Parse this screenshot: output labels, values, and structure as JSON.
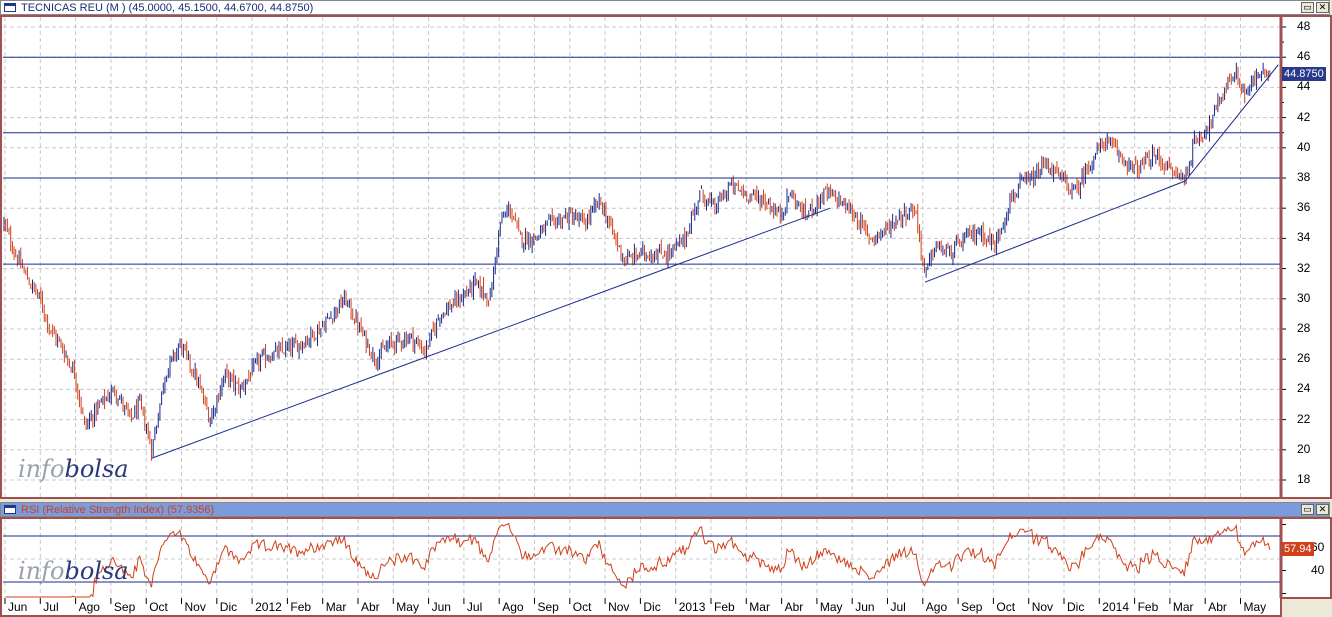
{
  "main_window": {
    "title": "TECNICAS REU (M ) (45.0000, 45.1500, 44.6700, 44.8750)",
    "last_price": "44.8750",
    "restore_icon": "restore-icon",
    "close_icon": "close-icon"
  },
  "rsi_window": {
    "title": "RSI (Relative Strength Index) (57.9356)",
    "last_value": "57.94"
  },
  "watermark": {
    "part1": "info",
    "part2": "bolsa"
  },
  "colors": {
    "up": "#1a2a8a",
    "down": "#d0401a",
    "line": "#1a2a8a",
    "rsi": "#d0401a",
    "frame": "#a05050"
  },
  "chart_data": [
    {
      "type": "ohlc",
      "title": "TECNICAS REU (M )",
      "ylim": [
        17,
        49
      ],
      "yticks": [
        18,
        20,
        22,
        24,
        26,
        28,
        30,
        32,
        34,
        36,
        38,
        40,
        42,
        44,
        46,
        48
      ],
      "x_unit": "months since Jun 2011",
      "keypoints": {
        "t": [
          0,
          0.31,
          0.74,
          1.02,
          1.3,
          1.59,
          2.01,
          2.29,
          2.72,
          3.14,
          3.57,
          3.85,
          4.19,
          4.56,
          4.99,
          5.41,
          5.84,
          6.26,
          6.69,
          7.25,
          7.82,
          8.39,
          8.95,
          9.66,
          10.08,
          10.51,
          10.93,
          11.5,
          11.93,
          12.35,
          12.92,
          13.34,
          13.77,
          14.05,
          14.33,
          14.62,
          15.04,
          15.47,
          16.03,
          16.46,
          16.88,
          17.31,
          17.59,
          18.02,
          18.44,
          18.87,
          19.29,
          19.72,
          20.14,
          20.57,
          20.99,
          21.56,
          21.98,
          22.27,
          22.69,
          23.26,
          23.68,
          24.11,
          24.53,
          24.96,
          25.38,
          25.81,
          26.09,
          26.37,
          26.8,
          27.22,
          27.65,
          28.07,
          28.5,
          28.78,
          29.21,
          29.49,
          29.92,
          30.34,
          30.76,
          31.19,
          31.61,
          32.04,
          32.61,
          33.03,
          33.46,
          33.74,
          34.16,
          34.59,
          34.87,
          35.16,
          35.58,
          35.86
        ],
        "close": [
          35,
          33,
          31,
          30,
          28,
          27,
          25,
          21.5,
          23,
          24,
          22,
          23,
          20,
          25,
          27,
          25,
          22,
          25,
          24,
          26,
          26.5,
          27,
          28,
          30,
          28,
          26,
          27,
          27.5,
          26.5,
          29,
          30,
          31,
          30,
          35,
          36,
          34,
          34,
          35,
          35.5,
          35,
          36.5,
          34,
          32.5,
          33,
          33,
          33,
          34,
          37,
          36,
          37.5,
          37,
          36.5,
          35.5,
          37,
          35.5,
          37,
          36.5,
          35.5,
          34,
          34.5,
          35.5,
          36,
          31.5,
          33.5,
          33,
          34,
          34.5,
          33.5,
          36.5,
          37.5,
          38,
          39,
          38,
          37,
          39,
          40.5,
          39.5,
          38.5,
          39.5,
          38.5,
          38,
          40.5,
          41.5,
          44,
          45,
          43.5,
          45,
          44.9
        ]
      },
      "horizontal_lines": [
        46,
        41,
        38,
        32.3
      ],
      "trendlines": [
        {
          "from": [
            4.19,
            19.45
          ],
          "to": [
            23.4,
            36.0
          ]
        },
        {
          "from": [
            26.09,
            31.1
          ],
          "to": [
            33.46,
            37.8
          ]
        },
        {
          "from": [
            33.46,
            37.8
          ],
          "to": [
            36.1,
            45.5
          ]
        }
      ],
      "last": {
        "open": 45.0,
        "high": 45.15,
        "low": 44.67,
        "close": 44.875
      }
    },
    {
      "type": "line",
      "title": "RSI (Relative Strength Index)",
      "period": 14,
      "ylim": [
        15,
        85
      ],
      "yticks": [
        40,
        60
      ],
      "levels": [
        70,
        30
      ],
      "last_value": 57.9356
    }
  ],
  "months": [
    "Jun",
    "Jul",
    "Ago",
    "Sep",
    "Oct",
    "Nov",
    "Dic",
    "2012",
    "Feb",
    "Mar",
    "Abr",
    "May",
    "Jun",
    "Jul",
    "Ago",
    "Sep",
    "Oct",
    "Nov",
    "Dic",
    "2013",
    "Feb",
    "Mar",
    "Abr",
    "May",
    "Jun",
    "Jul",
    "Ago",
    "Sep",
    "Oct",
    "Nov",
    "Dic",
    "2014",
    "Feb",
    "Mar",
    "Abr",
    "May"
  ]
}
